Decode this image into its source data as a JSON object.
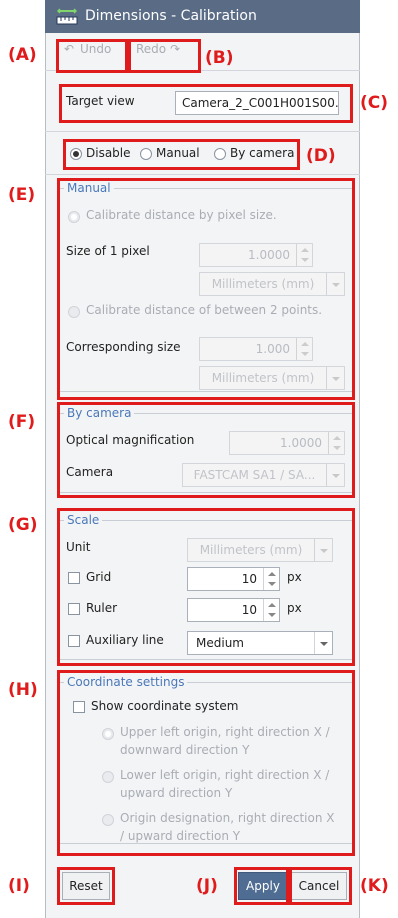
{
  "window": {
    "title": "Dimensions - Calibration"
  },
  "toolbar": {
    "undo_label": "Undo",
    "redo_label": "Redo"
  },
  "target_view": {
    "label": "Target view",
    "value": "Camera_2_C001H001S00..."
  },
  "mode": {
    "options": [
      "Disable",
      "Manual",
      "By camera"
    ],
    "selected": "Disable"
  },
  "manual": {
    "title": "Manual",
    "pixel_radio": "Calibrate distance by pixel size.",
    "size_label": "Size of 1 pixel",
    "size_value": "1.0000",
    "size_unit": "Millimeters (mm)",
    "two_points_radio": "Calibrate distance of between 2 points.",
    "corr_label": "Corresponding size",
    "corr_value": "1.000",
    "corr_unit": "Millimeters (mm)"
  },
  "by_camera": {
    "title": "By camera",
    "optical_label": "Optical magnification",
    "optical_value": "1.0000",
    "camera_label": "Camera",
    "camera_value": "FASTCAM SA1 / SA..."
  },
  "scale": {
    "title": "Scale",
    "unit_label": "Unit",
    "unit_value": "Millimeters (mm)",
    "grid_label": "Grid",
    "grid_value": "10",
    "grid_unit": "px",
    "ruler_label": "Ruler",
    "ruler_value": "10",
    "ruler_unit": "px",
    "aux_label": "Auxiliary line",
    "aux_value": "Medium"
  },
  "coords": {
    "title": "Coordinate settings",
    "show_label": "Show coordinate system",
    "opt1_line1": "Upper left origin, right direction X /",
    "opt1_line2": "downward direction Y",
    "opt2_line1": "Lower left origin, right direction X /",
    "opt2_line2": "upward direction Y",
    "opt3_line1": "Origin designation, right direction X",
    "opt3_line2": "/ upward direction Y"
  },
  "footer": {
    "reset_label": "Reset",
    "apply_label": "Apply",
    "cancel_label": "Cancel"
  },
  "callouts": {
    "A": "(A)",
    "B": "(B)",
    "C": "(C)",
    "D": "(D)",
    "E": "(E)",
    "F": "(F)",
    "G": "(G)",
    "H": "(H)",
    "I": "(I)",
    "J": "(J)",
    "K": "(K)"
  },
  "colors": {
    "title_bar": "#596b85",
    "annotation_red": "#e01b1b",
    "group_title": "#4a78b8",
    "apply_button": "#4f6d92"
  }
}
